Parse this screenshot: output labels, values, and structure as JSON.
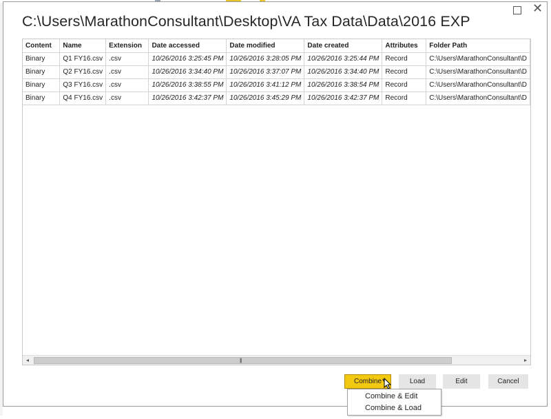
{
  "window": {
    "title": "C:\\Users\\MarathonConsultant\\Desktop\\VA Tax Data\\Data\\2016 EXP",
    "maximize_icon": "maximize-icon",
    "close_icon": "close-icon",
    "close_glyph": "✕"
  },
  "table": {
    "columns": [
      "Content",
      "Name",
      "Extension",
      "Date accessed",
      "Date modified",
      "Date created",
      "Attributes",
      "Folder Path"
    ],
    "rows": [
      [
        "Binary",
        "Q1 FY16.csv",
        ".csv",
        "10/26/2016 3:25:45 PM",
        "10/26/2016 3:28:05 PM",
        "10/26/2016 3:25:44 PM",
        "Record",
        "C:\\Users\\MarathonConsultant\\D"
      ],
      [
        "Binary",
        "Q2 FY16.csv",
        ".csv",
        "10/26/2016 3:34:40 PM",
        "10/26/2016 3:37:07 PM",
        "10/26/2016 3:34:40 PM",
        "Record",
        "C:\\Users\\MarathonConsultant\\D"
      ],
      [
        "Binary",
        "Q3 FY16.csv",
        ".csv",
        "10/26/2016 3:38:55 PM",
        "10/26/2016 3:41:12 PM",
        "10/26/2016 3:38:54 PM",
        "Record",
        "C:\\Users\\MarathonConsultant\\D"
      ],
      [
        "Binary",
        "Q4 FY16.csv",
        ".csv",
        "10/26/2016 3:42:37 PM",
        "10/26/2016 3:45:29 PM",
        "10/26/2016 3:42:37 PM",
        "Record",
        "C:\\Users\\MarathonConsultant\\D"
      ]
    ]
  },
  "scrollbar": {
    "left_arrow": "◂",
    "right_arrow": "▸",
    "grip": "|||"
  },
  "buttons": {
    "combine": "Combine",
    "combine_caret": "▾",
    "load": "Load",
    "edit": "Edit",
    "cancel": "Cancel"
  },
  "combine_menu": {
    "items": [
      "Combine & Edit",
      "Combine & Load"
    ]
  },
  "colors": {
    "accent": "#f2c811",
    "button_bg": "#e5e5e5",
    "grid_border": "#c8c8c8"
  }
}
